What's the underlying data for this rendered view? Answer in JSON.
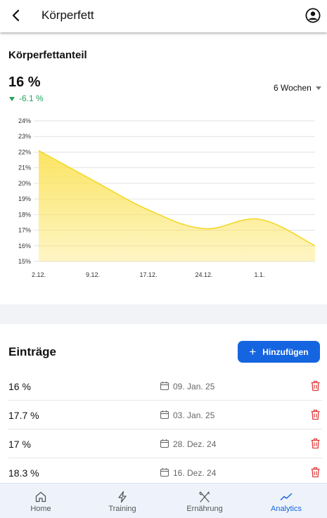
{
  "header": {
    "title": "Körperfett"
  },
  "summary": {
    "section_title": "Körperfettanteil",
    "current_value": "16 %",
    "delta": "-6.1 %",
    "period": "6 Wochen"
  },
  "chart_data": {
    "type": "area",
    "y_ticks": [
      "24%",
      "23%",
      "22%",
      "21%",
      "20%",
      "19%",
      "18%",
      "17%",
      "16%",
      "15%"
    ],
    "x_ticks": [
      "2.12.",
      "9.12.",
      "17.12.",
      "24.12.",
      "1.1."
    ],
    "ylim": [
      15,
      24
    ],
    "grid": true,
    "points": [
      {
        "x": "2.12.",
        "y": 22.1
      },
      {
        "x": "9.12.",
        "y": 20.2
      },
      {
        "x": "17.12.",
        "y": 18.3
      },
      {
        "x": "24.12.",
        "y": 17.1
      },
      {
        "x": "1.1.",
        "y": 17.7
      },
      {
        "x": "9.1.",
        "y": 16.0
      }
    ],
    "color": "#fbe35a"
  },
  "entries": {
    "title": "Einträge",
    "add_label": "Hinzufügen",
    "items": [
      {
        "value": "16 %",
        "date": "09. Jan. 25"
      },
      {
        "value": "17.7 %",
        "date": "03. Jan. 25"
      },
      {
        "value": "17 %",
        "date": "28. Dez. 24"
      },
      {
        "value": "18.3 %",
        "date": "16. Dez. 24"
      }
    ]
  },
  "nav": {
    "items": [
      {
        "label": "Home",
        "icon": "home-icon"
      },
      {
        "label": "Training",
        "icon": "lightning-icon"
      },
      {
        "label": "Ernährung",
        "icon": "utensils-icon"
      },
      {
        "label": "Analytics",
        "icon": "trend-icon"
      }
    ],
    "active": "Analytics",
    "accent": "#1565e0"
  }
}
